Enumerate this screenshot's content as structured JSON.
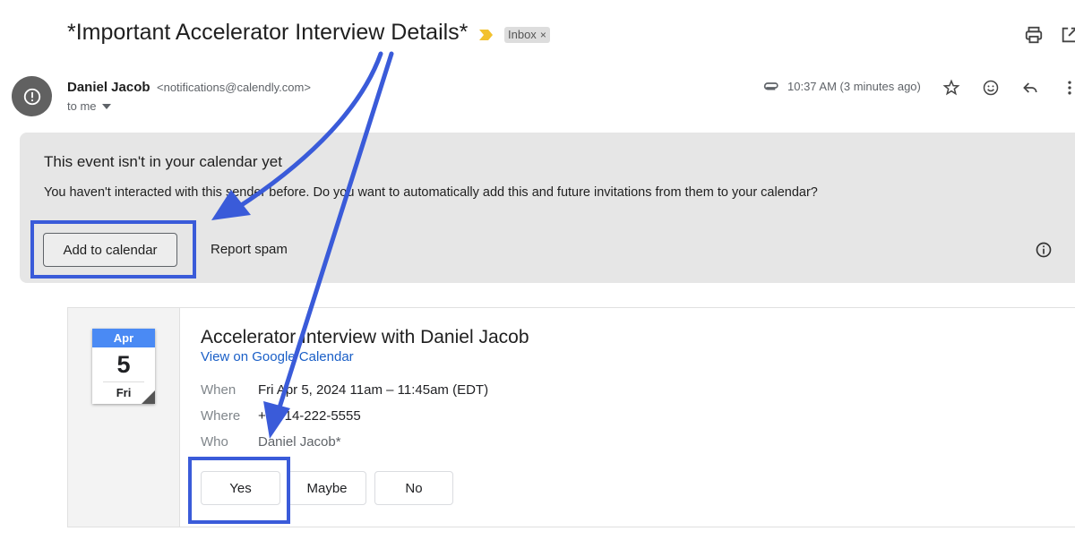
{
  "email": {
    "subject": "*Important Accelerator Interview Details*",
    "label": "Inbox",
    "label_remove": "×",
    "sender": {
      "name": "Daniel Jacob",
      "email": "<notifications@calendly.com>",
      "to": "to me",
      "timestamp": "10:37 AM (3 minutes ago)"
    }
  },
  "banner": {
    "title": "This event isn't in your calendar yet",
    "text": "You haven't interacted with this sender before. Do you want to automatically add this and future invitations from them to your calendar?",
    "add_label": "Add to calendar",
    "spam_label": "Report spam"
  },
  "event": {
    "month": "Apr",
    "day": "5",
    "weekday": "Fri",
    "title": "Accelerator Interview with Daniel Jacob",
    "link": "View on Google Calendar",
    "when_label": "When",
    "when": "Fri Apr 5, 2024 11am – 11:45am (EDT)",
    "where_label": "Where",
    "where": "+1 914-222-5555",
    "who_label": "Who",
    "who": "Daniel Jacob*",
    "rsvp": {
      "yes": "Yes",
      "maybe": "Maybe",
      "no": "No"
    }
  },
  "icons": {
    "print": "print-icon",
    "open_new_window": "open-in-new-window-icon",
    "attachment": "paperclip-icon",
    "star": "star-icon",
    "emoji": "emoji-icon",
    "reply": "reply-icon",
    "more": "more-vert-icon",
    "info": "info-icon",
    "spam_alert": "alert-icon"
  },
  "colors": {
    "highlight": "#3a5bd9",
    "calendar_header": "#4a8af4",
    "link": "#1a5fc7",
    "banner_bg": "#e6e6e6",
    "important_marker": "#f2c12e"
  }
}
